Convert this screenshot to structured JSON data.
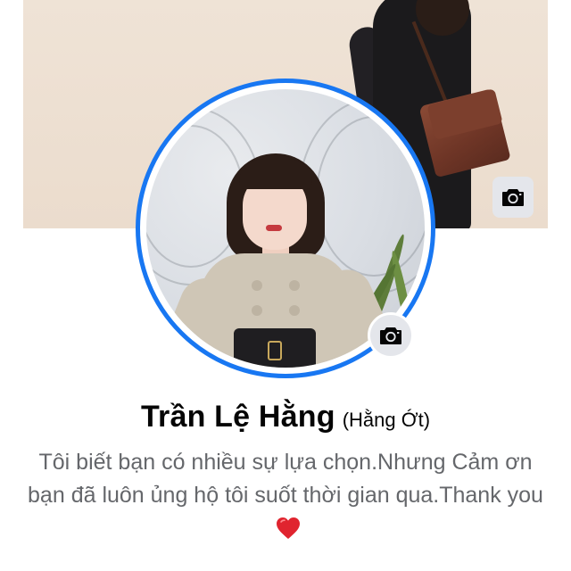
{
  "profile": {
    "name": "Trần Lệ Hằng",
    "alternate_name": "(Hằng Ớt)",
    "bio": "Tôi biết bạn có nhiều sự lựa chọn.Nhưng Cảm ơn bạn đã luôn ủng hộ tôi suốt thời gian qua.Thank you",
    "bio_emoji": "red-heart-icon"
  },
  "cover_photo": {
    "edit_icon": "camera-icon"
  },
  "profile_photo": {
    "edit_icon": "camera-icon"
  },
  "colors": {
    "accent": "#1877f2",
    "icon_button_bg": "#e4e6eb",
    "name_text": "#050505",
    "bio_text": "#65676b",
    "heart": "#e0242f"
  }
}
